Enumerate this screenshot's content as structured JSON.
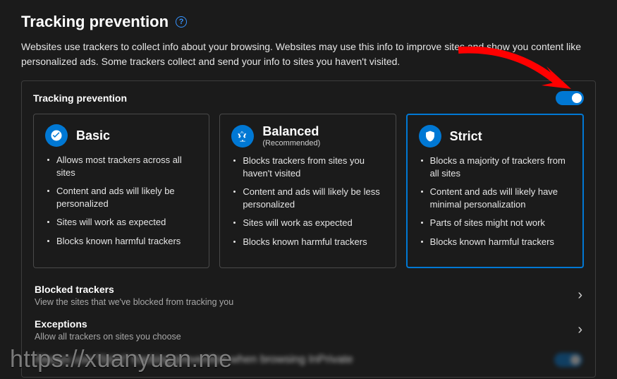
{
  "header": {
    "title": "Tracking prevention"
  },
  "intro": "Websites use trackers to collect info about your browsing. Websites may use this info to improve sites and show you content like personalized ads. Some trackers collect and send your info to sites you haven't visited.",
  "panel": {
    "label": "Tracking prevention",
    "toggle_on": true
  },
  "cards": [
    {
      "id": "basic",
      "title": "Basic",
      "subtitle": "",
      "selected": false,
      "bullets": [
        "Allows most trackers across all sites",
        "Content and ads will likely be personalized",
        "Sites will work as expected",
        "Blocks known harmful trackers"
      ]
    },
    {
      "id": "balanced",
      "title": "Balanced",
      "subtitle": "(Recommended)",
      "selected": false,
      "bullets": [
        "Blocks trackers from sites you haven't visited",
        "Content and ads will likely be less personalized",
        "Sites will work as expected",
        "Blocks known harmful trackers"
      ]
    },
    {
      "id": "strict",
      "title": "Strict",
      "subtitle": "",
      "selected": true,
      "bullets": [
        "Blocks a majority of trackers from all sites",
        "Content and ads will likely have minimal personalization",
        "Parts of sites might not work",
        "Blocks known harmful trackers"
      ]
    }
  ],
  "links": {
    "blocked": {
      "title": "Blocked trackers",
      "desc": "View the sites that we've blocked from tracking you"
    },
    "exceptions": {
      "title": "Exceptions",
      "desc": "Allow all trackers on sites you choose"
    }
  },
  "watermark": "https://xuanyuan.me"
}
